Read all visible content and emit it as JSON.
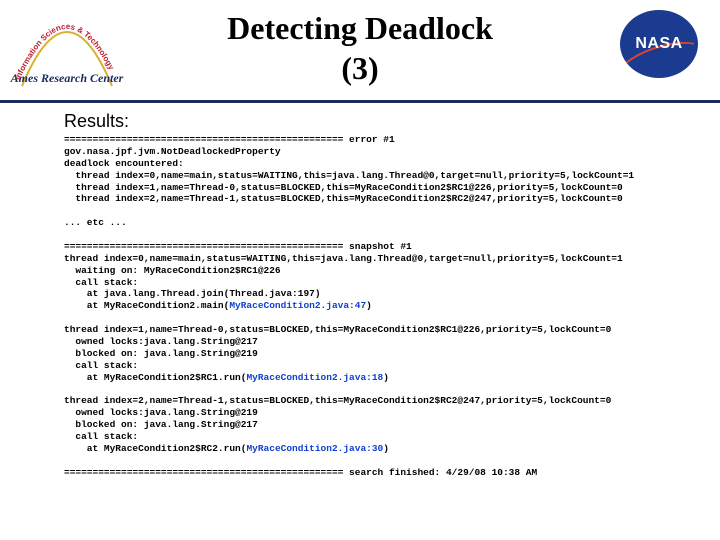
{
  "header": {
    "title_line1": "Detecting Deadlock",
    "title_line2": "(3)",
    "nasa_text": "NASA",
    "ames_text": "Ames Research Center"
  },
  "results_label": "Results:",
  "output": {
    "err_sep": "================================================= error #1",
    "err_class": "gov.nasa.jpf.jvm.NotDeadlockedProperty",
    "err_enc": "deadlock encountered:",
    "err_t0": "  thread index=0,name=main,status=WAITING,this=java.lang.Thread@0,target=null,priority=5,lockCount=1",
    "err_t1": "  thread index=1,name=Thread-0,status=BLOCKED,this=MyRaceCondition2$RC1@226,priority=5,lockCount=0",
    "err_t2": "  thread index=2,name=Thread-1,status=BLOCKED,this=MyRaceCondition2$RC2@247,priority=5,lockCount=0",
    "etc": "... etc ...",
    "snap_sep": "================================================= snapshot #1",
    "s0_head": "thread index=0,name=main,status=WAITING,this=java.lang.Thread@0,target=null,priority=5,lockCount=1",
    "s0_wait": "  waiting on: MyRaceCondition2$RC1@226",
    "s0_call": "  call stack:",
    "s0_st1": "    at java.lang.Thread.join(Thread.java:197)",
    "s0_st2a": "    at MyRaceCondition2.main(",
    "s0_st2b": "MyRaceCondition2.java:47",
    "s0_st2c": ")",
    "s1_head": "thread index=1,name=Thread-0,status=BLOCKED,this=MyRaceCondition2$RC1@226,priority=5,lockCount=0",
    "s1_own": "  owned locks:java.lang.String@217",
    "s1_blk": "  blocked on: java.lang.String@219",
    "s1_call": "  call stack:",
    "s1_st1a": "    at MyRaceCondition2$RC1.run(",
    "s1_st1b": "MyRaceCondition2.java:18",
    "s1_st1c": ")",
    "s2_head": "thread index=2,name=Thread-1,status=BLOCKED,this=MyRaceCondition2$RC2@247,priority=5,lockCount=0",
    "s2_own": "  owned locks:java.lang.String@219",
    "s2_blk": "  blocked on: java.lang.String@217",
    "s2_call": "  call stack:",
    "s2_st1a": "    at MyRaceCondition2$RC2.run(",
    "s2_st1b": "MyRaceCondition2.java:30",
    "s2_st1c": ")",
    "finish": "================================================= search finished: 4/29/08 10:38 AM"
  }
}
